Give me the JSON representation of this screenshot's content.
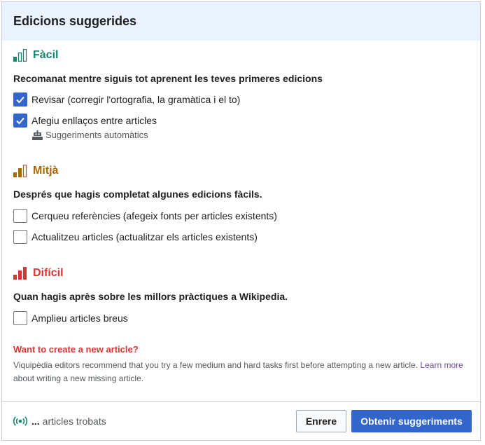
{
  "dialog": {
    "title": "Edicions suggerides"
  },
  "levels": [
    {
      "label": "Fàcil",
      "color": "#14866d",
      "icon": "difficulty-easy-icon",
      "description": "Recomanat mentre siguis tot aprenent les teves primeres edicions",
      "tasks": [
        {
          "label": "Revisar (corregir l'ortografia, la gramàtica i el to)",
          "checked": true
        },
        {
          "label": "Afegiu enllaços entre articles",
          "checked": true,
          "sublabel": "Suggeriments automàtics",
          "subicon": "robot-icon"
        }
      ]
    },
    {
      "label": "Mitjà",
      "color": "#ac6600",
      "icon": "difficulty-medium-icon",
      "description": "Després que hagis completat algunes edicions fàcils.",
      "tasks": [
        {
          "label": "Cerqueu referències (afegeix fonts per articles existents)",
          "checked": false
        },
        {
          "label": "Actualitzeu articles (actualitzar els articles existents)",
          "checked": false
        }
      ]
    },
    {
      "label": "Difícil",
      "color": "#d33",
      "icon": "difficulty-hard-icon",
      "description": "Quan hagis après sobre les millors pràctiques a Wikipedia.",
      "tasks": [
        {
          "label": "Amplieu articles breus",
          "checked": false
        }
      ]
    }
  ],
  "new_article": {
    "title": "Want to create a new article?",
    "text_before": "Viquipèdia editors recommend that you try a few medium and hard tasks first before attempting a new article.",
    "link": "Learn more",
    "text_after": "about writing a new missing article."
  },
  "footer": {
    "count_icon": "live-broadcast-icon",
    "count_value": "...",
    "count_label": "articles trobats",
    "back_label": "Enrere",
    "primary_label": "Obtenir suggeriments"
  },
  "colors": {
    "accent": "#3366cc",
    "header_bg": "#eaf3ff",
    "easy": "#14866d",
    "medium": "#ac6600",
    "hard": "#d33"
  }
}
